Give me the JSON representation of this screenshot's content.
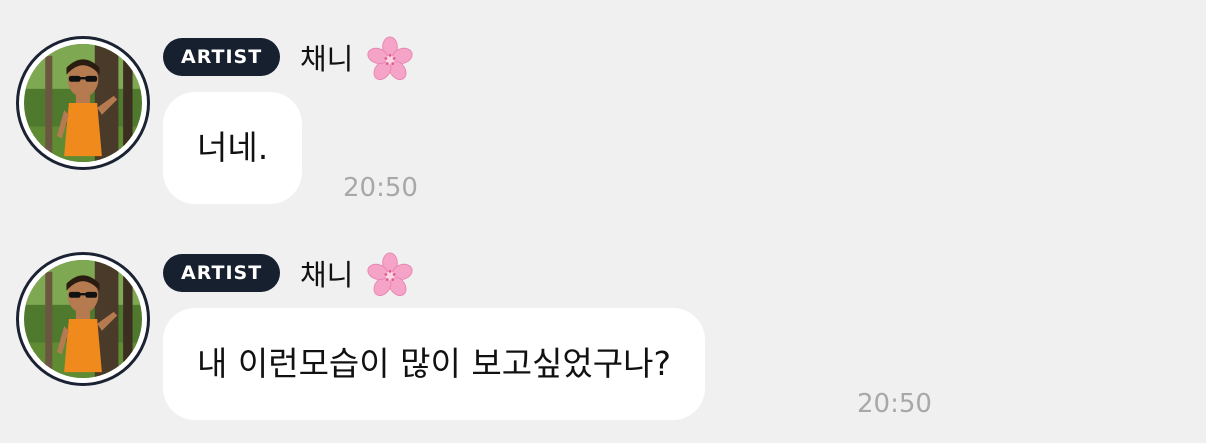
{
  "messages": [
    {
      "badge": "ARTIST",
      "sender": "채니",
      "sender_emoji_icon": "cherry-blossom-icon",
      "text": "너네.",
      "time": "20:50"
    },
    {
      "badge": "ARTIST",
      "sender": "채니",
      "sender_emoji_icon": "cherry-blossom-icon",
      "text": "내 이런모습이 많이 보고싶었구나?",
      "time": "20:50"
    }
  ],
  "colors": {
    "background": "#f0f0f0",
    "bubble": "#ffffff",
    "badge": "#17202f",
    "timestamp": "#a8a8a8",
    "flower": "#f5a3c7"
  }
}
